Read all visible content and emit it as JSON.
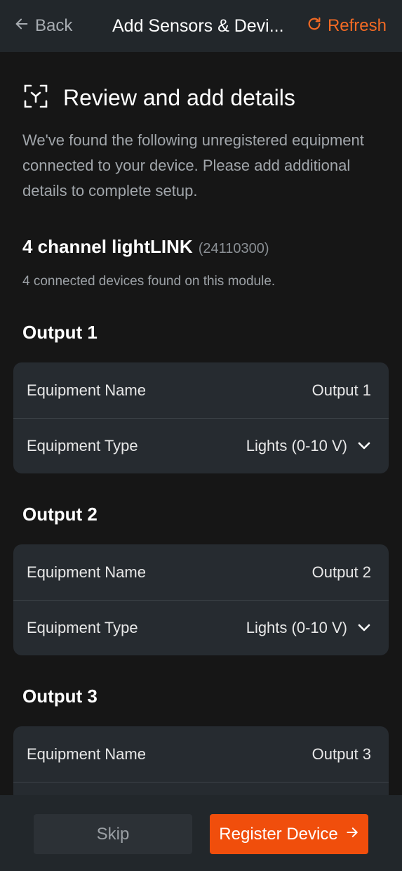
{
  "header": {
    "back_label": "Back",
    "back_icon": "arrow-left-icon",
    "title": "Add Sensors & Devi...",
    "refresh_label": "Refresh",
    "refresh_icon": "refresh-icon"
  },
  "section": {
    "icon": "scan-icon",
    "title": "Review and add details",
    "intro": "We've found the following unregistered equipment connected to your device. Please add additional details to complete setup."
  },
  "module": {
    "name": "4 channel lightLINK",
    "serial": "(24110300)",
    "subtitle": "4 connected devices found on this module."
  },
  "outputs": [
    {
      "title": "Output 1",
      "name_label": "Equipment Name",
      "name_value": "Output 1",
      "type_label": "Equipment Type",
      "type_value": "Lights (0-10 V)"
    },
    {
      "title": "Output 2",
      "name_label": "Equipment Name",
      "name_value": "Output 2",
      "type_label": "Equipment Type",
      "type_value": "Lights (0-10 V)"
    },
    {
      "title": "Output 3",
      "name_label": "Equipment Name",
      "name_value": "Output 3"
    }
  ],
  "footer": {
    "skip_label": "Skip",
    "register_label": "Register Device",
    "register_icon": "arrow-right-icon"
  },
  "colors": {
    "accent": "#f04e0c",
    "refresh": "#f36a24",
    "background": "#161616",
    "card": "#262b30",
    "header": "#22272b"
  }
}
